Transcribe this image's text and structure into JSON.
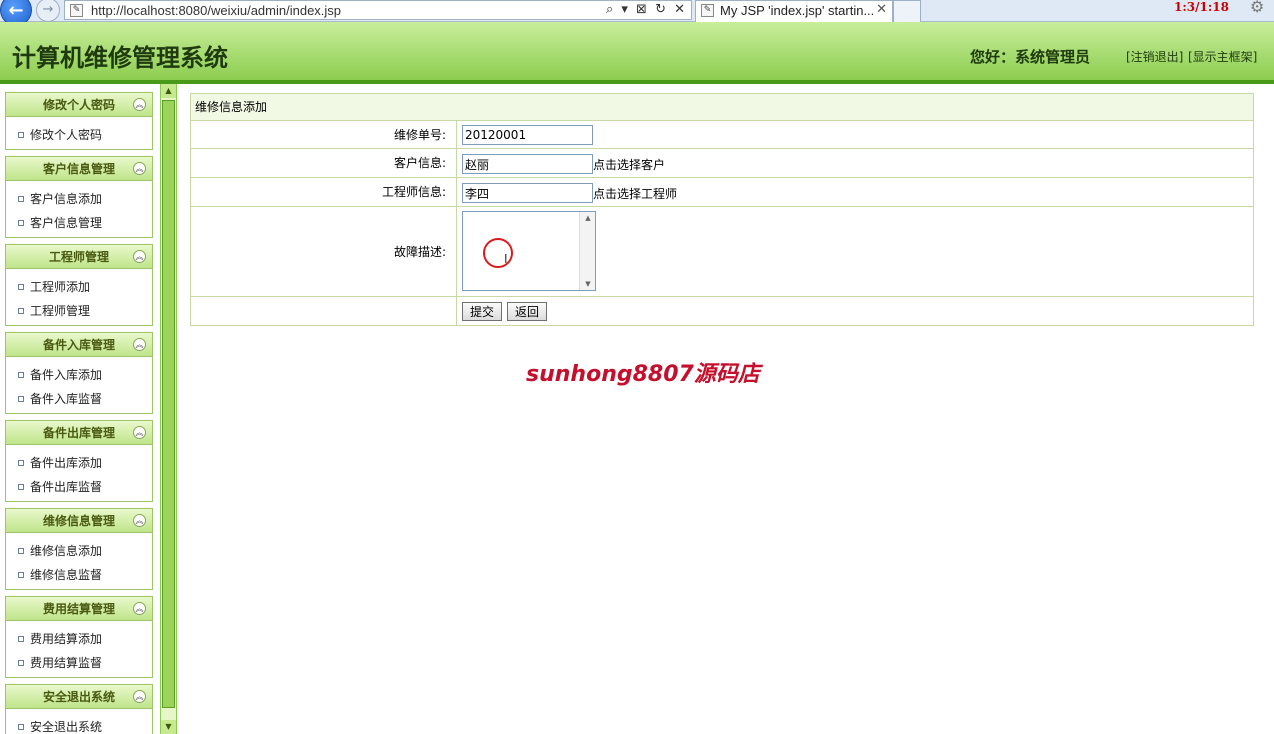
{
  "browser": {
    "url": "http://localhost:8080/weixiu/admin/index.jsp",
    "tab_title": "My JSP 'index.jsp' startin...",
    "address_tools": "⌕ ▾ ⊠ ↻ ✕",
    "clock": "1:3/1:18"
  },
  "header": {
    "title": "计算机维修管理系统",
    "greeting": "您好：系统管理员",
    "logout_label": "[注销退出]",
    "toggle_frame_label": "[显示主框架]"
  },
  "sidebar": {
    "sections": [
      {
        "title": "修改个人密码",
        "items": [
          "修改个人密码"
        ]
      },
      {
        "title": "客户信息管理",
        "items": [
          "客户信息添加",
          "客户信息管理"
        ]
      },
      {
        "title": "工程师管理",
        "items": [
          "工程师添加",
          "工程师管理"
        ]
      },
      {
        "title": "备件入库管理",
        "items": [
          "备件入库添加",
          "备件入库监督"
        ]
      },
      {
        "title": "备件出库管理",
        "items": [
          "备件出库添加",
          "备件出库监督"
        ]
      },
      {
        "title": "维修信息管理",
        "items": [
          "维修信息添加",
          "维修信息监督"
        ]
      },
      {
        "title": "费用结算管理",
        "items": [
          "费用结算添加",
          "费用结算监督"
        ]
      },
      {
        "title": "安全退出系统",
        "items": [
          "安全退出系统"
        ]
      }
    ]
  },
  "form": {
    "title": "维修信息添加",
    "order_no_label": "维修单号:",
    "order_no_value": "20120001",
    "customer_label": "客户信息:",
    "customer_value": "赵丽",
    "customer_pick": "点击选择客户",
    "engineer_label": "工程师信息:",
    "engineer_value": "李四",
    "engineer_pick": "点击选择工程师",
    "fault_label": "故障描述:",
    "fault_value": "",
    "submit_label": "提交",
    "back_label": "返回"
  },
  "watermark": "sunhong8807源码店"
}
